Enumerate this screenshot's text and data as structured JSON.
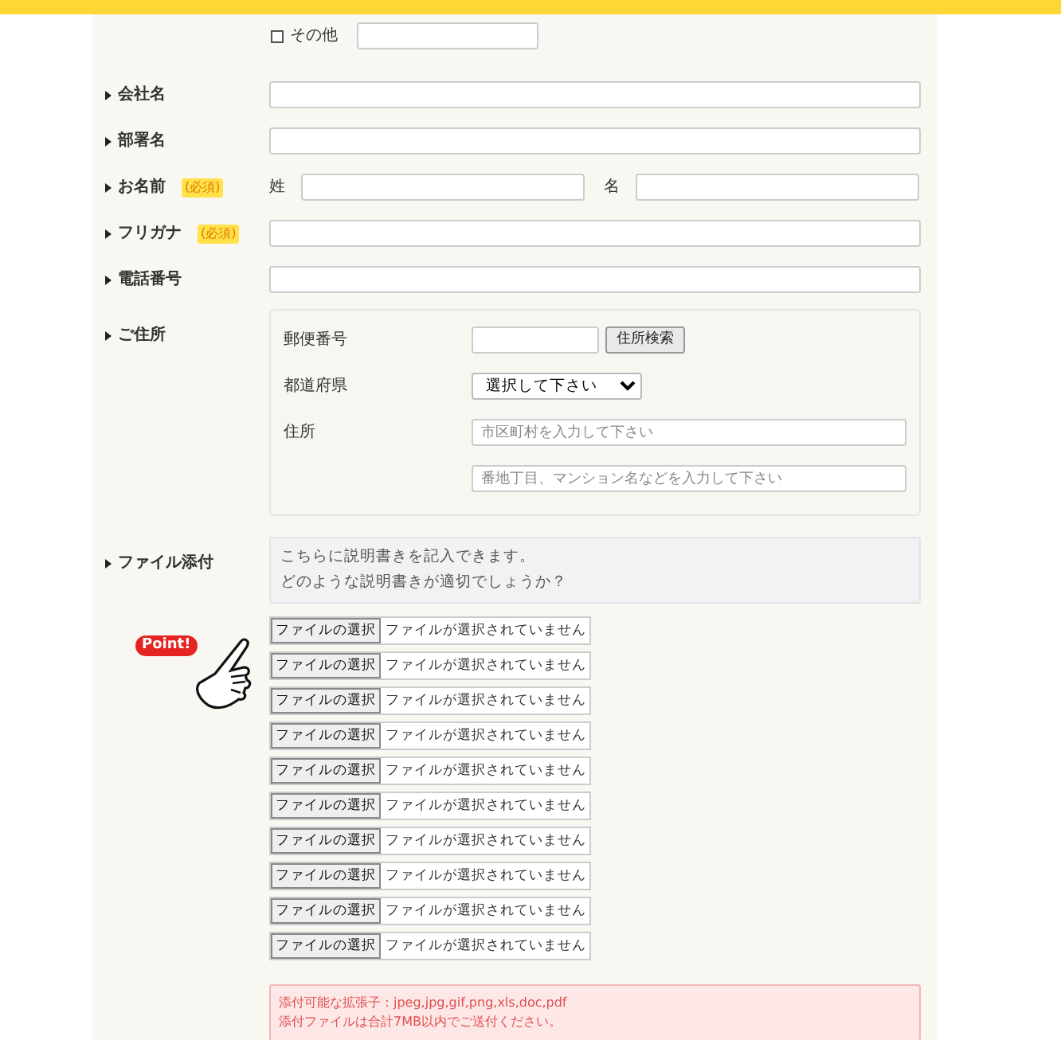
{
  "other_option": {
    "label": "その他",
    "checked": false
  },
  "fields": [
    {
      "label": "会社名",
      "kind": "single"
    },
    {
      "label": "部署名",
      "kind": "single"
    },
    {
      "label": "お名前",
      "required": true,
      "required_label": "(必須)",
      "kind": "name",
      "parts": [
        "姓",
        "名"
      ]
    },
    {
      "label": "フリガナ",
      "required": true,
      "required_label": "(必須)",
      "kind": "single"
    },
    {
      "label": "電話番号",
      "kind": "single"
    }
  ],
  "address": {
    "label": "ご住所",
    "postal_label": "郵便番号",
    "search_button": "住所検索",
    "prefecture_label": "都道府県",
    "prefecture_value": "選択して下さい",
    "address_label": "住所",
    "address_placeholders": [
      "市区町村を入力して下さい",
      "番地丁目、マンション名などを入力して下さい"
    ]
  },
  "attachment": {
    "label": "ファイル添付",
    "description": [
      "こちらに説明書きを記入できます。",
      "どのような説明書きが適切でしょうか？"
    ],
    "point_label": "Point!",
    "files": [
      {
        "button": "ファイルの選択",
        "status": "ファイルが選択されていません"
      },
      {
        "button": "ファイルの選択",
        "status": "ファイルが選択されていません"
      },
      {
        "button": "ファイルの選択",
        "status": "ファイルが選択されていません"
      },
      {
        "button": "ファイルの選択",
        "status": "ファイルが選択されていません"
      },
      {
        "button": "ファイルの選択",
        "status": "ファイルが選択されていません"
      },
      {
        "button": "ファイルの選択",
        "status": "ファイルが選択されていません"
      },
      {
        "button": "ファイルの選択",
        "status": "ファイルが選択されていません"
      },
      {
        "button": "ファイルの選択",
        "status": "ファイルが選択されていません"
      },
      {
        "button": "ファイルの選択",
        "status": "ファイルが選択されていません"
      },
      {
        "button": "ファイルの選択",
        "status": "ファイルが選択されていません"
      }
    ],
    "notice": [
      "添付可能な拡張子：jpeg,jpg,gif,png,xls,doc,pdf",
      "添付ファイルは合計7MB以内でご送付ください。"
    ]
  }
}
